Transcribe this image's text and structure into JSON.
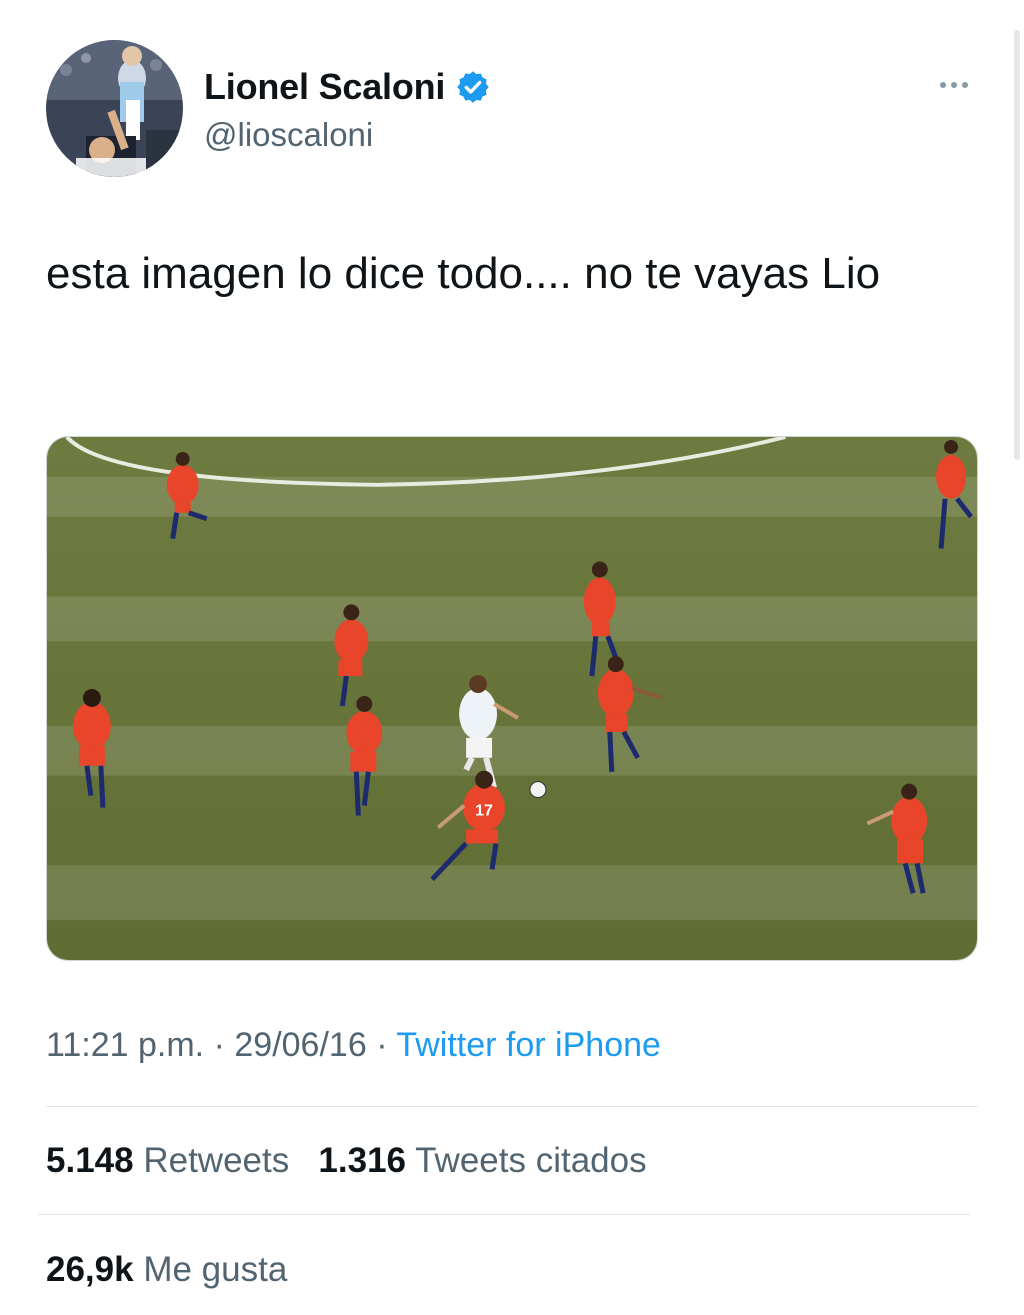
{
  "tweet": {
    "author": {
      "display_name": "Lionel Scaloni",
      "handle": "@lioscaloni"
    },
    "text": "esta imagen lo dice todo.... no te vayas Lio",
    "time": "11:21 p.m.",
    "separator": "·",
    "date": "29/06/16",
    "source": "Twitter for iPhone",
    "media": {
      "players": [
        {
          "team": "chile",
          "number": "17"
        }
      ]
    }
  },
  "stats": {
    "retweets_count": "5.148",
    "retweets_label": "Retweets",
    "quotes_count": "1.316",
    "quotes_label": "Tweets citados",
    "likes_count": "26,9k",
    "likes_label": "Me gusta"
  },
  "colors": {
    "link": "#1d9bf0",
    "verified": "#1d9bf0",
    "secondary_text": "#536471",
    "primary_text": "#0f1419",
    "chile_shirt": "#e8452a",
    "pitch": "#6f7f3e"
  },
  "icons": {
    "verified": "verified-badge-icon",
    "more": "more-options-icon"
  }
}
